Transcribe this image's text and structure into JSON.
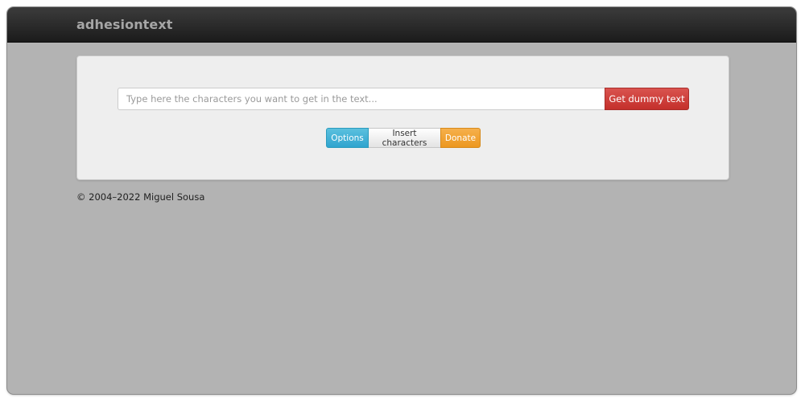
{
  "navbar": {
    "brand": "adhesiontext"
  },
  "main": {
    "input": {
      "value": "",
      "placeholder": "Type here the characters you want to get in the text..."
    },
    "submit_label": "Get dummy text",
    "buttons": {
      "options_label": "Options",
      "insert_label": "Insert characters",
      "donate_label": "Donate"
    }
  },
  "footer": {
    "text": "© 2004–2022 Miguel Sousa"
  },
  "colors": {
    "navbar": "#222222",
    "background": "#b3b3b3",
    "panel": "#eeeeee",
    "danger": "#d9534f",
    "info": "#5bc0de",
    "warning": "#f0ad4e"
  }
}
